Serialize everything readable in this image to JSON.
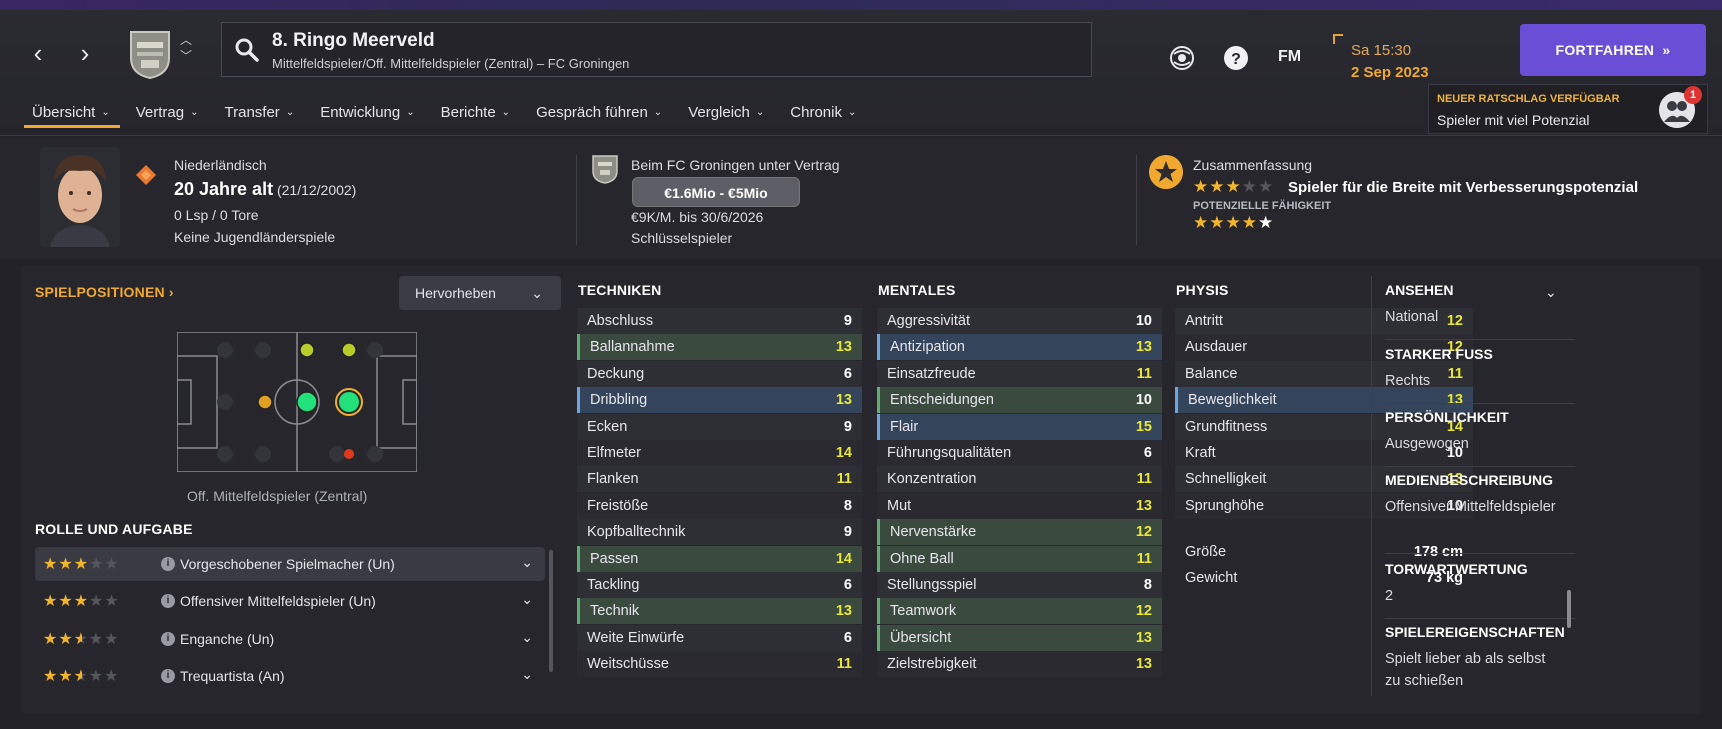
{
  "header": {
    "player_title": "8. Ringo Meerveld",
    "player_subtitle": "Mittelfeldspieler/Off. Mittelfeldspieler (Zentral) – FC Groningen",
    "time": "Sa 15:30",
    "date": "2 Sep 2023",
    "fm_logo": "FM",
    "continue_label": "FORTFAHREN",
    "advice_title": "NEUER RATSCHLAG VERFÜGBAR",
    "advice_text": "Spieler mit viel Potenzial",
    "advice_count": "1"
  },
  "tabs": [
    "Übersicht",
    "Vertrag",
    "Transfer",
    "Entwicklung",
    "Berichte",
    "Gespräch führen",
    "Vergleich",
    "Chronik"
  ],
  "overview": {
    "nationality": "Niederländisch",
    "age": "20 Jahre alt",
    "birthdate": "(21/12/2002)",
    "caps": "0 Lsp / 0 Tore",
    "youth": "Keine Jugendländerspiele",
    "contract_club": "Beim FC Groningen unter Vertrag",
    "value_range": "€1.6Mio - €5Mio",
    "wage": "€9K/M. bis 30/6/2026",
    "status": "Schlüsselspieler",
    "summary_title": "Zusammenfassung",
    "summary_text": "Spieler für die Breite mit Verbesserungspotenzial",
    "current_ability_stars": 3,
    "potential_label": "POTENZIELLE FÄHIGKEIT",
    "potential_ability_stars": 5
  },
  "positions": {
    "title": "SPIELPOSITIONEN",
    "highlight_label": "Hervorheben",
    "position_label": "Off. Mittelfeldspieler (Zentral)"
  },
  "roles": {
    "title": "ROLLE UND AUFGABE",
    "items": [
      {
        "name": "Vorgeschobener Spielmacher (Un)",
        "stars": 3
      },
      {
        "name": "Offensiver Mittelfeldspieler (Un)",
        "stars": 3
      },
      {
        "name": "Enganche (Un)",
        "stars": 2.5
      },
      {
        "name": "Trequartista (An)",
        "stars": 2.5
      }
    ]
  },
  "attributes": {
    "technical": {
      "title": "TECHNIKEN",
      "items": [
        {
          "name": "Abschluss",
          "value": "9",
          "hl": ""
        },
        {
          "name": "Ballannahme",
          "value": "13",
          "hl": "g"
        },
        {
          "name": "Deckung",
          "value": "6",
          "hl": ""
        },
        {
          "name": "Dribbling",
          "value": "13",
          "hl": "b"
        },
        {
          "name": "Ecken",
          "value": "9",
          "hl": ""
        },
        {
          "name": "Elfmeter",
          "value": "14",
          "hl": ""
        },
        {
          "name": "Flanken",
          "value": "11",
          "hl": ""
        },
        {
          "name": "Freistöße",
          "value": "8",
          "hl": ""
        },
        {
          "name": "Kopfballtechnik",
          "value": "9",
          "hl": ""
        },
        {
          "name": "Passen",
          "value": "14",
          "hl": "g"
        },
        {
          "name": "Tackling",
          "value": "6",
          "hl": ""
        },
        {
          "name": "Technik",
          "value": "13",
          "hl": "g"
        },
        {
          "name": "Weite Einwürfe",
          "value": "6",
          "hl": ""
        },
        {
          "name": "Weitschüsse",
          "value": "11",
          "hl": ""
        }
      ]
    },
    "mental": {
      "title": "MENTALES",
      "items": [
        {
          "name": "Aggressivität",
          "value": "10",
          "hl": ""
        },
        {
          "name": "Antizipation",
          "value": "13",
          "hl": "b"
        },
        {
          "name": "Einsatzfreude",
          "value": "11",
          "hl": ""
        },
        {
          "name": "Entscheidungen",
          "value": "10",
          "hl": "g"
        },
        {
          "name": "Flair",
          "value": "15",
          "hl": "b"
        },
        {
          "name": "Führungsqualitäten",
          "value": "6",
          "hl": ""
        },
        {
          "name": "Konzentration",
          "value": "11",
          "hl": ""
        },
        {
          "name": "Mut",
          "value": "13",
          "hl": ""
        },
        {
          "name": "Nervenstärke",
          "value": "12",
          "hl": "g"
        },
        {
          "name": "Ohne Ball",
          "value": "11",
          "hl": "g"
        },
        {
          "name": "Stellungsspiel",
          "value": "8",
          "hl": ""
        },
        {
          "name": "Teamwork",
          "value": "12",
          "hl": "g"
        },
        {
          "name": "Übersicht",
          "value": "13",
          "hl": "g"
        },
        {
          "name": "Zielstrebigkeit",
          "value": "13",
          "hl": ""
        }
      ]
    },
    "physical": {
      "title": "PHYSIS",
      "items": [
        {
          "name": "Antritt",
          "value": "12",
          "hl": ""
        },
        {
          "name": "Ausdauer",
          "value": "12",
          "hl": ""
        },
        {
          "name": "Balance",
          "value": "11",
          "hl": ""
        },
        {
          "name": "Beweglichkeit",
          "value": "13",
          "hl": "b"
        },
        {
          "name": "Grundfitness",
          "value": "14",
          "hl": ""
        },
        {
          "name": "Kraft",
          "value": "10",
          "hl": ""
        },
        {
          "name": "Schnelligkeit",
          "value": "13",
          "hl": ""
        },
        {
          "name": "Sprunghöhe",
          "value": "10",
          "hl": ""
        }
      ],
      "height_label": "Größe",
      "height_value": "178 cm",
      "weight_label": "Gewicht",
      "weight_value": "73 kg"
    }
  },
  "side": {
    "reputation_label": "ANSEHEN",
    "reputation_value": "National",
    "foot_label": "STARKER FUSS",
    "foot_value": "Rechts",
    "personality_label": "PERSÖNLICHKEIT",
    "personality_value": "Ausgewogen",
    "media_label": "MEDIENBESCHREIBUNG",
    "media_value": "Offensiver Mittelfeldspieler",
    "gk_label": "TORWARTWERTUNG",
    "gk_value": "2",
    "traits_label": "SPIELEREIGENSCHAFTEN",
    "traits_value": "Spielt lieber ab als selbst zu schießen"
  },
  "colors": {
    "accent": "#f0a830",
    "button": "#6a4fd6",
    "value_yellow": "#e8e636",
    "highlight_green": "#3b4a3f",
    "highlight_blue": "#34445a"
  }
}
